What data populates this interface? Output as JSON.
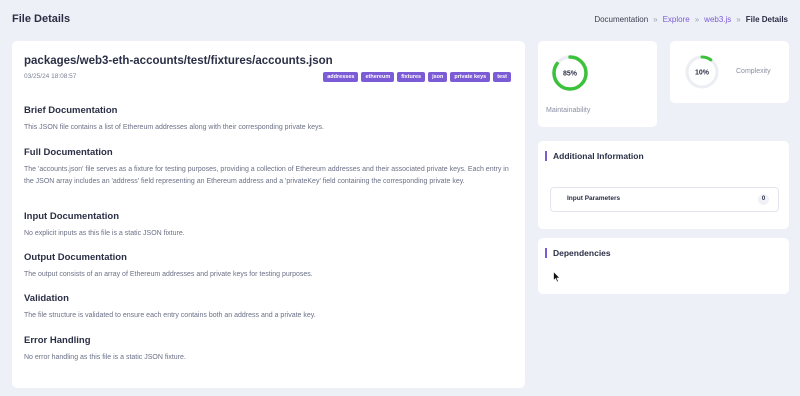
{
  "header": {
    "title": "File Details",
    "breadcrumb": {
      "root": "Documentation",
      "sep": "»",
      "explore": "Explore",
      "repo": "web3.js",
      "separator_last": "»",
      "current": "File Details"
    }
  },
  "file": {
    "path": "packages/web3-eth-accounts/test/fixtures/accounts.json",
    "date": "03/25/24 18:08:57",
    "tags": [
      "addresses",
      "ethereum",
      "fixtures",
      "json",
      "private keys",
      "test"
    ]
  },
  "sections": [
    {
      "title": "Brief Documentation",
      "text": "This JSON file contains a list of Ethereum addresses along with their corresponding private keys."
    },
    {
      "title": "Full Documentation",
      "text": "The 'accounts.json' file serves as a fixture for testing purposes, providing a collection of Ethereum addresses and their associated private keys. Each entry in the JSON array includes an 'address' field representing an Ethereum address and a 'privateKey' field containing the corresponding private key."
    },
    {
      "title": "Input Documentation",
      "text": "No explicit inputs as this file is a static JSON fixture."
    },
    {
      "title": "Output Documentation",
      "text": "The output consists of an array of Ethereum addresses and private keys for testing purposes."
    },
    {
      "title": "Validation",
      "text": "The file structure is validated to ensure each entry contains both an address and a private key."
    },
    {
      "title": "Error Handling",
      "text": "No error handling as this file is a static JSON fixture."
    }
  ],
  "metrics": {
    "maintainability": {
      "label": "Maintainability",
      "value": "85%",
      "fraction": 0.85,
      "color": "#3cc13b"
    },
    "complexity": {
      "label": "Complexity",
      "value": "10%",
      "fraction": 0.1,
      "color": "#3cc13b"
    }
  },
  "additional": {
    "title": "Additional Information",
    "param_label": "Input Parameters",
    "param_count": "0"
  },
  "dependencies": {
    "title": "Dependencies"
  },
  "colors": {
    "accent": "#7c5cd6",
    "gauge": "#3cc13b",
    "track": "#eceef4"
  }
}
